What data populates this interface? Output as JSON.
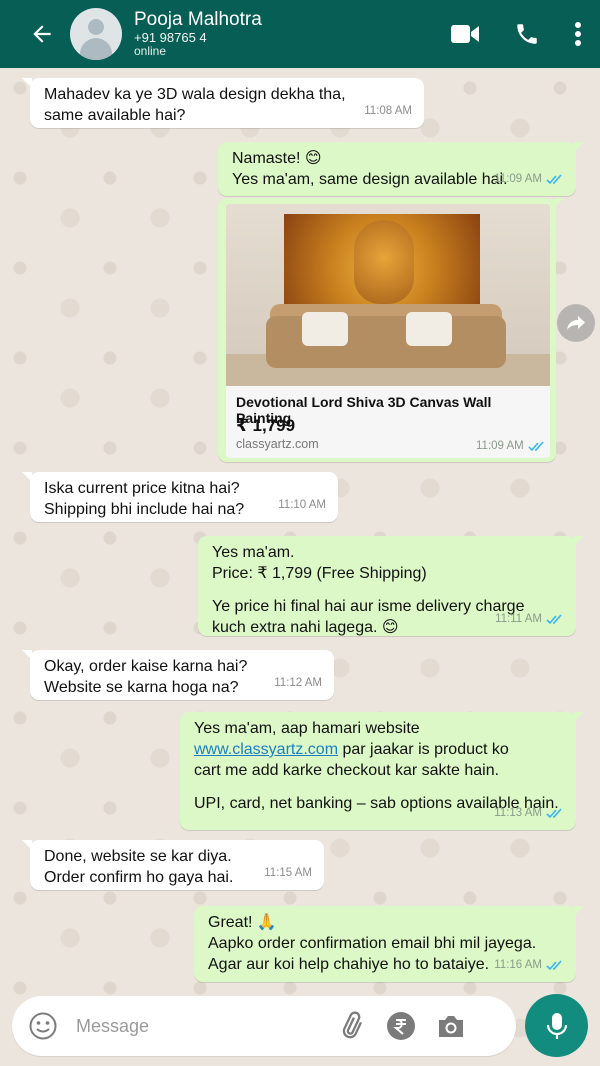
{
  "header": {
    "contact_name": "Pooja Malhotra",
    "phone": "+91 98765 4",
    "status": "online",
    "color": "#075e54"
  },
  "messages": [
    {
      "dir": "in",
      "lines": [
        "Mahadev ka ye 3D wala design dekha tha,",
        "same available hai?"
      ],
      "time": "11:08 AM"
    },
    {
      "dir": "out",
      "lines": [
        "Namaste! 😊",
        "Yes ma'am, same design available hai."
      ],
      "time": "11:09 AM"
    },
    {
      "dir": "out",
      "type": "product",
      "title": "Devotional Lord Shiva 3D Canvas Wall Painting",
      "price": "₹ 1,799",
      "domain": "classyartz.com",
      "time": "11:09 AM"
    },
    {
      "dir": "in",
      "lines": [
        "Iska current price kitna hai?",
        "Shipping bhi include hai na?"
      ],
      "time": "11:10 AM"
    },
    {
      "dir": "out",
      "lines": [
        "Yes ma'am.",
        "Price: ₹ 1,799 (Free Shipping)",
        "Ye price hi final hai aur isme delivery charge",
        "kuch extra nahi lagega. 😊"
      ],
      "time": "11:11 AM"
    },
    {
      "dir": "in",
      "lines": [
        "Okay, order kaise karna hai?",
        "Website se karna hoga na?"
      ],
      "time": "11:12 AM"
    },
    {
      "dir": "out",
      "lines": [
        "Yes ma'am, aap hamari website",
        "www.classyartz.com",
        "par jaakar is product ko",
        "cart me add karke checkout kar sakte hain.",
        "UPI, card, net banking – sab options available hain."
      ],
      "time": "11:13 AM"
    },
    {
      "dir": "in",
      "lines": [
        "Done, website se kar diya.",
        "Order confirm ho gaya hai."
      ],
      "time": "11:15 AM"
    },
    {
      "dir": "out",
      "lines": [
        "Great! 🙏",
        "Aapko order confirmation email bhi mil jayega.",
        "Agar aur koi help chahiye ho to bataiye."
      ],
      "time": "11:16 AM"
    }
  ],
  "composer": {
    "placeholder": "Message"
  },
  "colors": {
    "incoming": "#ffffff",
    "outgoing": "#dcf8c6",
    "ticks": "#34b7f1",
    "accent": "#128c7e"
  },
  "icons": {
    "back": "arrow-left-icon",
    "video": "video-camera-icon",
    "call": "phone-icon",
    "menu": "more-vertical-icon",
    "emoji": "emoji-icon",
    "attach": "paperclip-icon",
    "payment": "rupee-icon",
    "camera": "camera-icon",
    "mic": "microphone-icon",
    "forward": "forward-icon"
  }
}
